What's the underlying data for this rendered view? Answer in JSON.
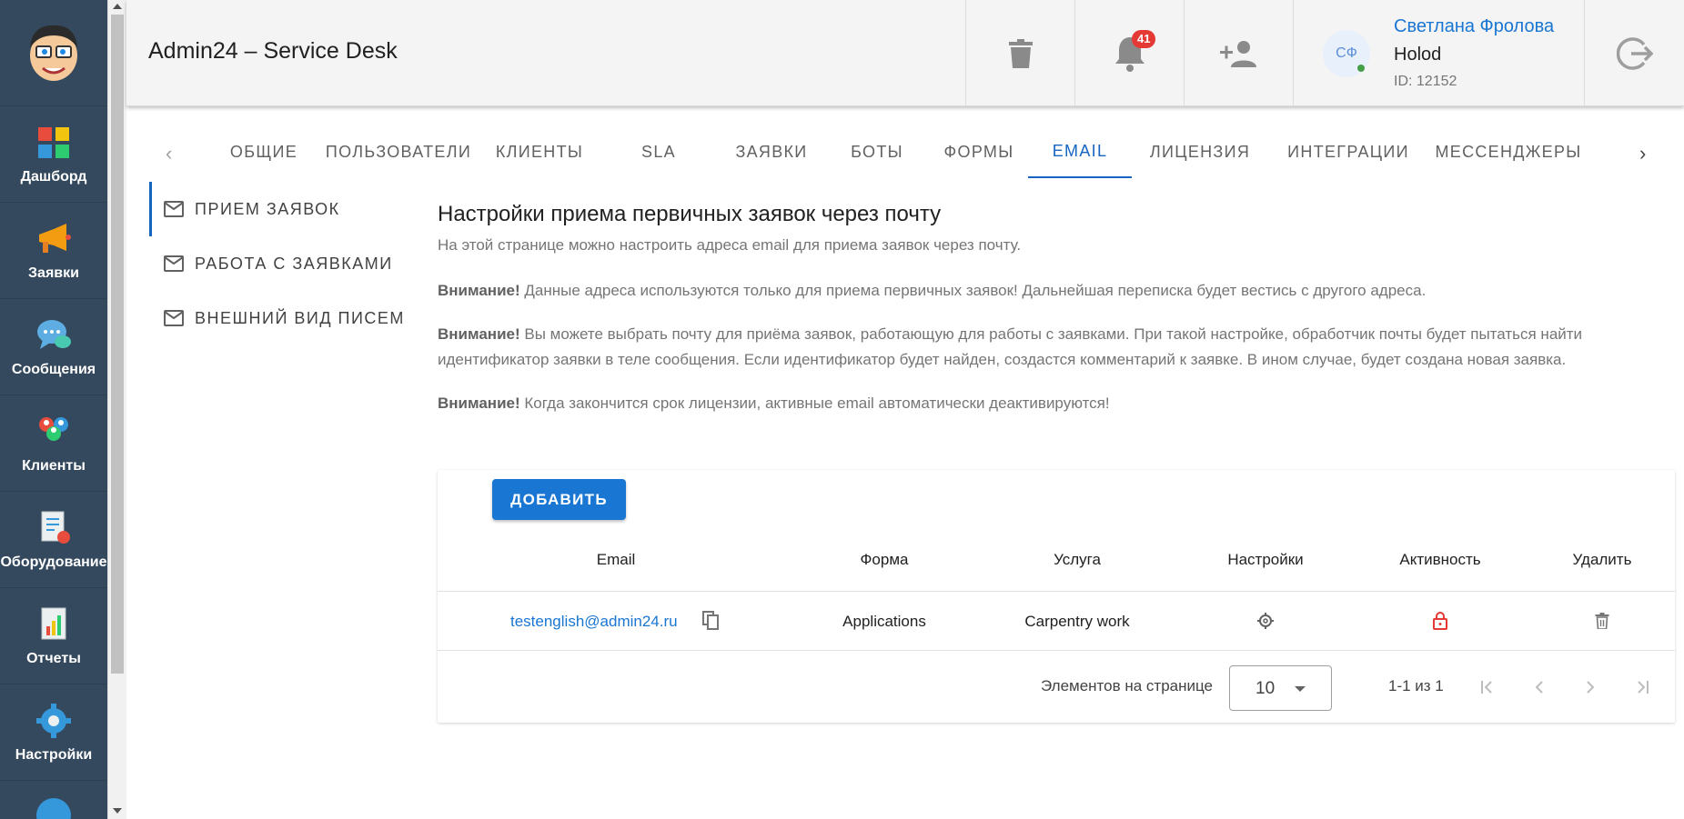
{
  "app": {
    "title": "Admin24 – Service Desk"
  },
  "nav": {
    "items": [
      {
        "label": "Дашборд",
        "icon": "dashboard-icon"
      },
      {
        "label": "Заявки",
        "icon": "megaphone-icon"
      },
      {
        "label": "Сообщения",
        "icon": "chat-icon"
      },
      {
        "label": "Клиенты",
        "icon": "clients-icon"
      },
      {
        "label": "Оборудование",
        "icon": "equipment-icon"
      },
      {
        "label": "Отчеты",
        "icon": "reports-icon"
      },
      {
        "label": "Настройки",
        "icon": "gear-icon"
      }
    ]
  },
  "header": {
    "notifications_count": "41",
    "user": {
      "initials": "СФ",
      "name": "Светлана Фролова",
      "company": "Holod",
      "id_text": "ID: 12152"
    }
  },
  "tabs": [
    {
      "label": "ОБЩИЕ"
    },
    {
      "label": "ПОЛЬЗОВАТЕЛИ"
    },
    {
      "label": "КЛИЕНТЫ"
    },
    {
      "label": "SLA"
    },
    {
      "label": "ЗАЯВКИ"
    },
    {
      "label": "БОТЫ"
    },
    {
      "label": "ФОРМЫ"
    },
    {
      "label": "EMAIL"
    },
    {
      "label": "ЛИЦЕНЗИЯ"
    },
    {
      "label": "ИНТЕГРАЦИИ"
    },
    {
      "label": "МЕССЕНДЖЕРЫ"
    }
  ],
  "active_tab": "EMAIL",
  "sidemenu": [
    {
      "label": "ПРИЕМ ЗАЯВОК"
    },
    {
      "label": "РАБОТА С ЗАЯВКАМИ"
    },
    {
      "label": "ВНЕШНИЙ ВИД ПИСЕМ"
    }
  ],
  "content": {
    "title": "Настройки приема первичных заявок через почту",
    "description": "На этой странице можно настроить адреса email для приема заявок через почту.",
    "warning_label": "Внимание!",
    "note1": " Данные адреса используются только для приема первичных заявок! Дальнейшая переписка будет вестись с другого адреса.",
    "note2": " Вы можете выбрать почту для приёма заявок, работающую для работы с заявками. При такой настройке, обработчик почты будет пытаться найти идентификатор заявки в теле сообщения. Если идентификатор будет найден, создастся комментарий к заявке. В ином случае, будет создана новая заявка.",
    "note3": " Когда закончится срок лицензии, активные email автоматически деактивируются!"
  },
  "table": {
    "add_label": "ДОБАВИТЬ",
    "columns": [
      "Email",
      "Форма",
      "Услуга",
      "Настройки",
      "Активность",
      "Удалить"
    ],
    "rows": [
      {
        "email": "testenglish@admin24.ru",
        "form": "Applications",
        "service": "Carpentry work"
      }
    ],
    "footer": {
      "per_page_label": "Элементов на странице",
      "per_page_value": "10",
      "range": "1-1 из 1"
    }
  },
  "colors": {
    "nav_bg": "#34495e",
    "accent": "#1976d2",
    "badge": "#e53935",
    "lock_red": "#e53935"
  }
}
